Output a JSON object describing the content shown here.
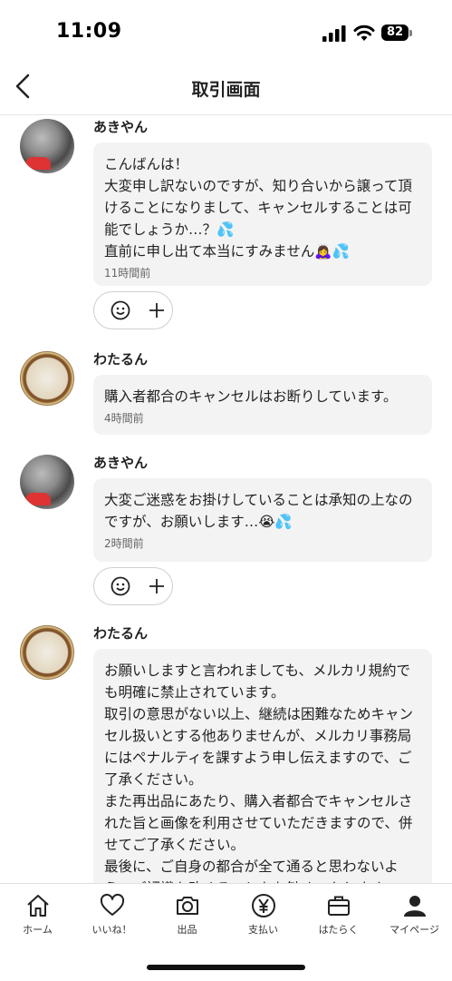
{
  "status": {
    "time": "11:09",
    "battery": "82"
  },
  "header": {
    "title": "取引画面"
  },
  "messages": [
    {
      "sender": "あきやん",
      "text": "こんばんは！\n大変申し訳ないのですが、知り合いから譲って頂けることになりまして、キャンセルすることは可能でしょうか…？💦\n直前に申し出て本当にすみません🙇‍♀️💦",
      "time": "11時間前"
    },
    {
      "sender": "わたるん",
      "text": "購入者都合のキャンセルはお断りしています。",
      "time": "4時間前"
    },
    {
      "sender": "あきやん",
      "text": "大変ご迷惑をお掛けしていることは承知の上なのですが、お願いします…😭💦",
      "time": "2時間前"
    },
    {
      "sender": "わたるん",
      "text": "お願いしますと言われましても、メルカリ規約でも明確に禁止されています。\n取引の意思がない以上、継続は困難なためキャンセル扱いとする他ありませんが、メルカリ事務局にはペナルティを課すよう申し伝えますので、ご了承ください。\nまた再出品にあたり、購入者都合でキャンセルされた旨と画像を利用させていただきますので、併せてご了承ください。\n最後に、ご自身の都合が全て通ると思わないよう、ご認識を改めることをお勧めいたします。",
      "time": ""
    }
  ],
  "tabs": [
    {
      "label": "ホーム",
      "icon": "home-icon"
    },
    {
      "label": "いいね！",
      "icon": "heart-icon"
    },
    {
      "label": "出品",
      "icon": "camera-icon"
    },
    {
      "label": "支払い",
      "icon": "yen-icon"
    },
    {
      "label": "はたらく",
      "icon": "briefcase-icon"
    },
    {
      "label": "マイページ",
      "icon": "person-icon"
    }
  ]
}
